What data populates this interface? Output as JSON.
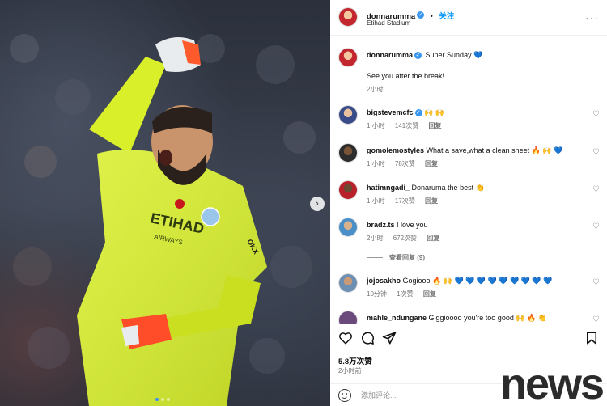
{
  "photo": {
    "jersey_sponsor": "ETIHAD",
    "jersey_sponsor_sub": "AIRWAYS",
    "jersey_number_patch": "OKX",
    "next_icon": "chevron-right-icon",
    "carousel_dots": 3,
    "carousel_active": 1
  },
  "header": {
    "username": "donnarumma",
    "follow_label": "关注",
    "location": "Etihad Stadium",
    "more_icon": "more-horizontal-icon"
  },
  "caption": {
    "username": "donnarumma",
    "text": "Super Sunday 💙",
    "body": "See you after the break!",
    "time": "2小时"
  },
  "comments": [
    {
      "username": "bigstevemcfc",
      "text": "🙌 🙌",
      "time": "1 小时",
      "likes": "141次赞",
      "reply": "回复"
    },
    {
      "username": "gomolemostyles",
      "text": "What a save,what a clean sheet 🔥 🙌 💙",
      "time": "1 小时",
      "likes": "78次赞",
      "reply": "回复"
    },
    {
      "username": "hatimngadi_",
      "text": "Donaruma the best 👏",
      "time": "1 小时",
      "likes": "17次赞",
      "reply": "回复"
    },
    {
      "username": "bradz.ts",
      "text": "I love you",
      "time": "2小时",
      "likes": "672次赞",
      "reply": "回复",
      "view_replies": "查看回复 (9)"
    },
    {
      "username": "jojosakho",
      "text": "Gogiooo 🔥 🙌 💙 💙 💙 💙 💙 💙 💙 💙 💙",
      "time": "10分钟",
      "likes": "1次赞",
      "reply": "回复"
    },
    {
      "username": "mahle_ndungane",
      "text": "Giggioooo you're too good 🙌 🔥 👏"
    }
  ],
  "actions": {
    "likes": "5.8万次赞",
    "time": "2小时前"
  },
  "add_comment": {
    "placeholder": "添加评论..."
  },
  "watermark": "news",
  "colors": {
    "accent": "#0095f6",
    "verified": "#3897f0",
    "jersey": "#d8ef2a"
  }
}
